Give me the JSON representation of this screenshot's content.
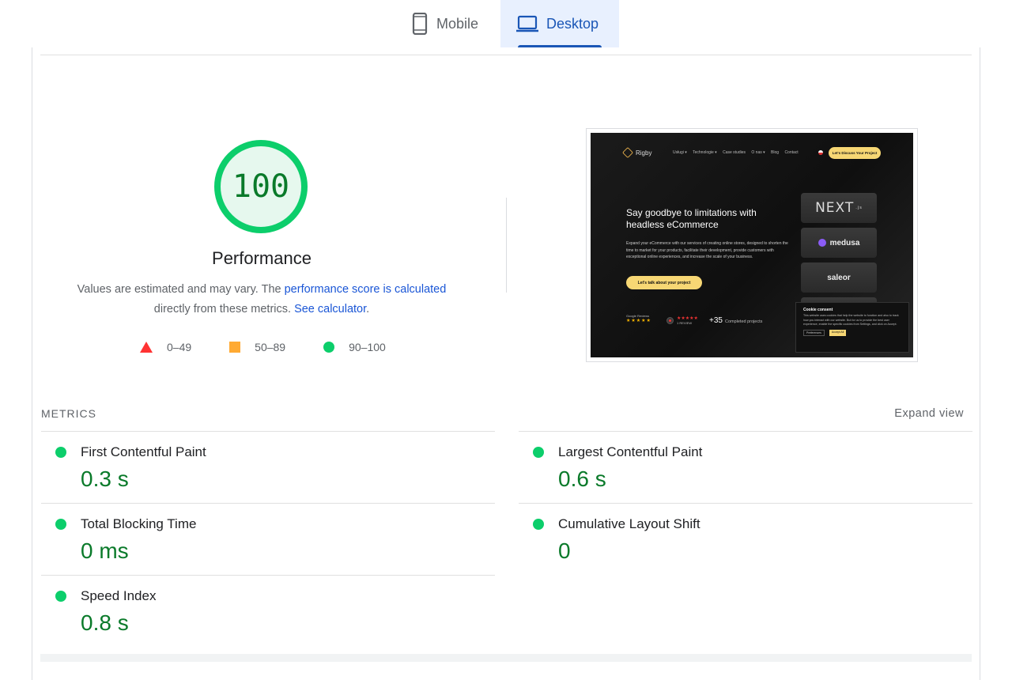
{
  "tabs": [
    {
      "label": "Mobile",
      "icon": "smartphone-icon",
      "active": false
    },
    {
      "label": "Desktop",
      "icon": "laptop-icon",
      "active": true
    }
  ],
  "score": {
    "value": "100",
    "fraction": 1.0,
    "title": "Performance",
    "color": "#0cce6b",
    "text_color": "#0a7a2a"
  },
  "description": {
    "text1": "Values are estimated and may vary. The ",
    "link1": "performance score is calculated",
    "text2": "directly from these metrics. ",
    "link2": "See calculator",
    "text3": "."
  },
  "legend": [
    {
      "range": "0–49",
      "shape": "triangle",
      "color": "#ff3333"
    },
    {
      "range": "50–89",
      "shape": "square",
      "color": "#ffaa33"
    },
    {
      "range": "90–100",
      "shape": "circle",
      "color": "#0cce6b"
    }
  ],
  "thumbnail": {
    "brand": "Rigby",
    "nav": [
      "Usługi ▾",
      "Technologie ▾",
      "Case studies",
      "O nas ▾",
      "Blog",
      "Contact"
    ],
    "cta": "Let's Discuss Your Project",
    "headline": "Say goodbye to limitations with headless eCommerce",
    "paragraph": "Expand your eCommerce with our services of creating online stores, designed to shorten the time to market for your products, facilitate their development, provide customers with exceptional online experiences, and increase the scale of your business.",
    "button": "Let's talk about your project",
    "tech": [
      "NEXT",
      ".js",
      "medusa",
      "saleor"
    ],
    "reviews_label": "Google Reviews",
    "reviews_stars": "★★★★★",
    "review_count": "1 REVIEW",
    "completed_number": "+35",
    "completed_label": "Completed projects",
    "cookie": {
      "title": "Cookie consent",
      "text": "This website uses cookies that help the website to function and also to track how you interact with our website. But for us to provide the best user experience, enable the specific cookies from Settings, and click on Accept.",
      "preferences": "Preferences",
      "accept": "Accept All"
    }
  },
  "metrics_section": {
    "label": "METRICS",
    "expand": "Expand view"
  },
  "metrics": [
    {
      "name": "First Contentful Paint",
      "value": "0.3 s",
      "status_color": "#0cce6b"
    },
    {
      "name": "Largest Contentful Paint",
      "value": "0.6 s",
      "status_color": "#0cce6b"
    },
    {
      "name": "Total Blocking Time",
      "value": "0 ms",
      "status_color": "#0cce6b"
    },
    {
      "name": "Cumulative Layout Shift",
      "value": "0",
      "status_color": "#0cce6b"
    },
    {
      "name": "Speed Index",
      "value": "0.8 s",
      "status_color": "#0cce6b"
    }
  ]
}
